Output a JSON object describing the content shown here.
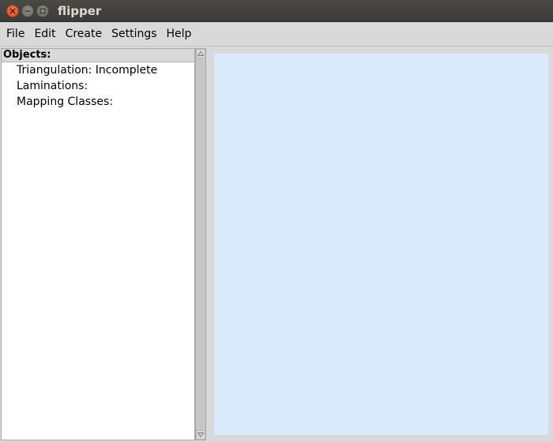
{
  "window": {
    "title": "flipper",
    "controls": [
      "close-icon",
      "minimize-icon",
      "maximize-icon"
    ],
    "close_color": "#df4a16"
  },
  "menubar": {
    "items": [
      "File",
      "Edit",
      "Create",
      "Settings",
      "Help"
    ]
  },
  "tree": {
    "header": "Objects:",
    "items": [
      "Triangulation: Incomplete",
      "Laminations:",
      "Mapping Classes:"
    ]
  },
  "canvas": {
    "background": "#dbeafb"
  }
}
